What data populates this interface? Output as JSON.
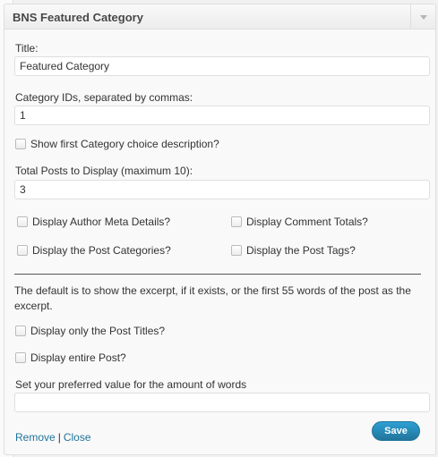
{
  "widget": {
    "title": "BNS Featured Category",
    "fields": {
      "title_label": "Title:",
      "title_value": "Featured Category",
      "category_ids_label": "Category IDs, separated by commas:",
      "category_ids_value": "1",
      "show_first_desc_label": "Show first Category choice description?",
      "total_posts_label": "Total Posts to Display (maximum 10):",
      "total_posts_value": "3",
      "author_meta_label": "Display Author Meta Details?",
      "comment_totals_label": "Display Comment Totals?",
      "post_categories_label": "Display the Post Categories?",
      "post_tags_label": "Display the Post Tags?",
      "excerpt_desc": "The default is to show the excerpt, if it exists, or the first 55 words of the post as the excerpt.",
      "only_titles_label": "Display only the Post Titles?",
      "entire_post_label": "Display entire Post?",
      "word_amount_label": "Set your preferred value for the amount of words",
      "word_amount_value": ""
    },
    "actions": {
      "remove": "Remove",
      "separator": "|",
      "close": "Close",
      "save": "Save"
    }
  }
}
